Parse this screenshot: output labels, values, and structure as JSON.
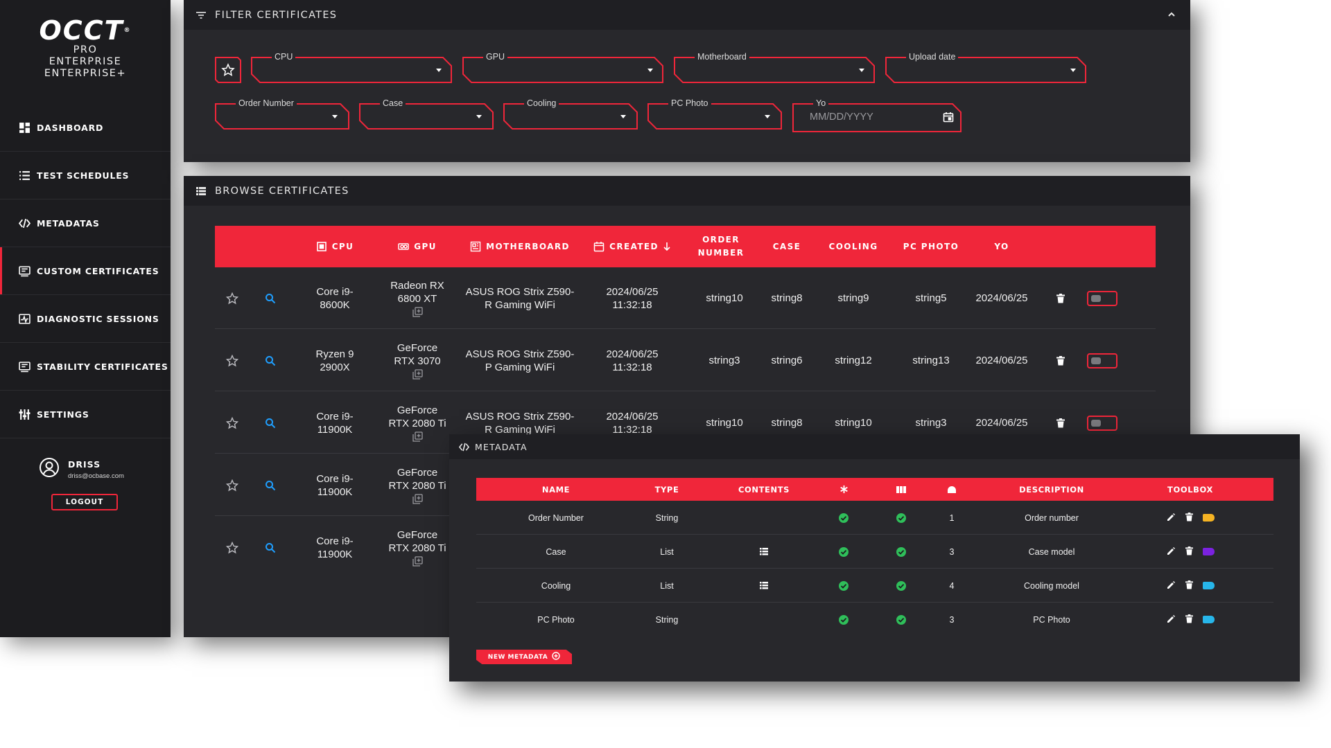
{
  "brand": {
    "logo": "OCCT",
    "lines": [
      "PRO",
      "ENTERPRISE",
      "ENTERPRISE+"
    ]
  },
  "nav": [
    {
      "label": "DASHBOARD",
      "icon": "dashboard-icon",
      "active": false
    },
    {
      "label": "TEST SCHEDULES",
      "icon": "list-icon",
      "active": false
    },
    {
      "label": "METADATAS",
      "icon": "code-icon",
      "active": false
    },
    {
      "label": "CUSTOM CERTIFICATES",
      "icon": "certificate-icon",
      "active": true
    },
    {
      "label": "DIAGNOSTIC SESSIONS",
      "icon": "diagnostic-icon",
      "active": false
    },
    {
      "label": "STABILITY CERTIFICATES",
      "icon": "certificate-icon",
      "active": false
    },
    {
      "label": "SETTINGS",
      "icon": "sliders-icon",
      "active": false
    }
  ],
  "user": {
    "name": "DRISS",
    "email": "driss@ocbase.com",
    "logout": "LOGOUT"
  },
  "filter": {
    "title": "FILTER CERTIFICATES",
    "fields_row1": [
      "CPU",
      "GPU",
      "Motherboard",
      "Upload date"
    ],
    "fields_row2": [
      "Order Number",
      "Case",
      "Cooling",
      "PC Photo"
    ],
    "date_field": {
      "label": "Yo",
      "placeholder": "MM/DD/YYYY"
    }
  },
  "browse": {
    "title": "BROWSE CERTIFICATES",
    "columns": [
      "CPU",
      "GPU",
      "MOTHERBOARD",
      "CREATED",
      "ORDER NUMBER",
      "CASE",
      "COOLING",
      "PC PHOTO",
      "YO"
    ],
    "rows": [
      {
        "cpu": "Core i9-8600K",
        "gpu": "Radeon RX 6800 XT",
        "motherboard": "ASUS ROG Strix Z590-R Gaming WiFi",
        "created": "2024/06/25 11:32:18",
        "order": "string10",
        "case": "string8",
        "cooling": "string9",
        "photo": "string5",
        "yo": "2024/06/25"
      },
      {
        "cpu": "Ryzen 9 2900X",
        "gpu": "GeForce RTX 3070",
        "motherboard": "ASUS ROG Strix Z590-P Gaming WiFi",
        "created": "2024/06/25 11:32:18",
        "order": "string3",
        "case": "string6",
        "cooling": "string12",
        "photo": "string13",
        "yo": "2024/06/25"
      },
      {
        "cpu": "Core i9-11900K",
        "gpu": "GeForce RTX 2080 Ti",
        "motherboard": "ASUS ROG Strix Z590-R Gaming WiFi",
        "created": "2024/06/25 11:32:18",
        "order": "string10",
        "case": "string8",
        "cooling": "string10",
        "photo": "string3",
        "yo": "2024/06/25"
      },
      {
        "cpu": "Core i9-11900K",
        "gpu": "GeForce RTX 2080 Ti"
      },
      {
        "cpu": "Core i9-11900K",
        "gpu": "GeForce RTX 2080 Ti"
      }
    ]
  },
  "metadata": {
    "title": "METADATA",
    "columns": [
      "NAME",
      "TYPE",
      "CONTENTS",
      "DESCRIPTION",
      "TOOLBOX"
    ],
    "rows": [
      {
        "name": "Order Number",
        "type": "String",
        "has_list": false,
        "number": "1",
        "description": "Order number",
        "tag_color": "#f5b323"
      },
      {
        "name": "Case",
        "type": "List",
        "has_list": true,
        "number": "3",
        "description": "Case model",
        "tag_color": "#7b22e0"
      },
      {
        "name": "Cooling",
        "type": "List",
        "has_list": true,
        "number": "4",
        "description": "Cooling model",
        "tag_color": "#27b6ea"
      },
      {
        "name": "PC Photo",
        "type": "String",
        "has_list": false,
        "number": "3",
        "description": "PC Photo",
        "tag_color": "#27b6ea"
      }
    ],
    "new_button": "NEW METADATA"
  },
  "colors": {
    "accent": "#f0263a",
    "check": "#2fbf5a",
    "search": "#1f9fff"
  }
}
